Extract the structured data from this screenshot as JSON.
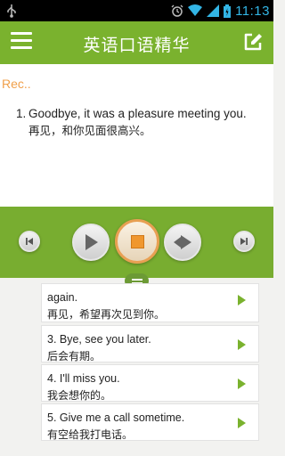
{
  "status_bar": {
    "time": "11:13",
    "icons": [
      "usb-icon",
      "alarm-icon",
      "wifi-icon",
      "signal-icon",
      "battery-icon"
    ],
    "accent_color": "#33b5e5"
  },
  "header": {
    "title": "英语口语精华",
    "menu_icon": "menu-icon",
    "action_icon": "edit-icon",
    "background": "#7ab22e"
  },
  "recording": {
    "label": "Rec.."
  },
  "current_sentence": {
    "number": "1.",
    "english": "Goodbye, it was a pleasure meeting you.",
    "chinese": "再见，和你见面很高兴。"
  },
  "player": {
    "buttons": [
      "skip-previous-icon",
      "play-icon",
      "stop-icon",
      "fast-forward-icon",
      "skip-next-icon"
    ],
    "background": "#78ad30",
    "stop_accent": "#f0972e"
  },
  "list": {
    "items": [
      {
        "english": "again.",
        "chinese": "再见，希望再次见到你。"
      },
      {
        "english": "3. Bye, see you later.",
        "chinese": "后会有期。"
      },
      {
        "english": "4. I'll miss you.",
        "chinese": "我会想你的。"
      },
      {
        "english": "5. Give me a call sometime.",
        "chinese": "有空给我打电话。"
      }
    ]
  }
}
